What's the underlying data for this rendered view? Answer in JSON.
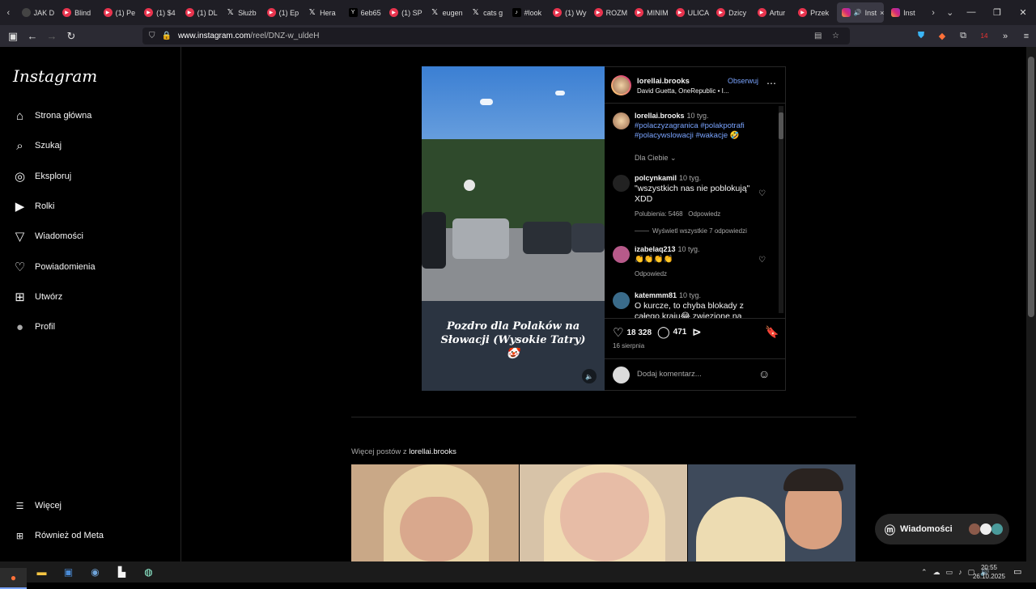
{
  "browser": {
    "tabs": [
      {
        "label": "JAK D",
        "icon": "generic"
      },
      {
        "label": "Blind",
        "icon": "youtube"
      },
      {
        "label": "(1) Pe",
        "icon": "youtube"
      },
      {
        "label": "(1) $4",
        "icon": "youtube"
      },
      {
        "label": "(1) DL",
        "icon": "youtube"
      },
      {
        "label": "Służb",
        "icon": "x"
      },
      {
        "label": "(1) Ep",
        "icon": "youtube"
      },
      {
        "label": "Hera",
        "icon": "x"
      },
      {
        "label": "6eb65",
        "icon": "y"
      },
      {
        "label": "(1) SP",
        "icon": "youtube"
      },
      {
        "label": "eugen",
        "icon": "x"
      },
      {
        "label": "cats g",
        "icon": "x"
      },
      {
        "label": "#look",
        "icon": "tiktok"
      },
      {
        "label": "(1) Wy",
        "icon": "youtube"
      },
      {
        "label": "ROZM",
        "icon": "youtube"
      },
      {
        "label": "MINIM",
        "icon": "youtube"
      },
      {
        "label": "ULICA",
        "icon": "youtube"
      },
      {
        "label": "Dzicy",
        "icon": "youtube"
      },
      {
        "label": "Artur",
        "icon": "youtube"
      },
      {
        "label": "Przek",
        "icon": "youtube"
      }
    ],
    "active_tab": {
      "label": "Inst"
    },
    "after_tab": {
      "label": "Inst"
    },
    "url_prefix": "www.instagram.com",
    "url_path": "/reel/DNZ-w_uldeH",
    "extension_badge": "14"
  },
  "sidebar": {
    "logo": "Instagram",
    "items": [
      {
        "label": "Strona główna",
        "icon": "home-icon"
      },
      {
        "label": "Szukaj",
        "icon": "search-icon"
      },
      {
        "label": "Eksploruj",
        "icon": "compass-icon"
      },
      {
        "label": "Rolki",
        "icon": "reels-icon"
      },
      {
        "label": "Wiadomości",
        "icon": "send-icon"
      },
      {
        "label": "Powiadomienia",
        "icon": "heart-icon"
      },
      {
        "label": "Utwórz",
        "icon": "plus-square-icon"
      },
      {
        "label": "Profil",
        "icon": "profile-avatar"
      }
    ],
    "bottom_items": [
      {
        "label": "Więcej",
        "icon": "menu-icon"
      },
      {
        "label": "Również od Meta",
        "icon": "meta-icon"
      }
    ]
  },
  "post": {
    "caption_overlay": "Pozdro dla Polaków na Słowacji (Wysokie Tatry) 🤡",
    "username": "lorellai.brooks",
    "follow_label": "Obserwuj",
    "music": "David Guetta, OneRepublic • I...",
    "caption": {
      "username": "lorellai.brooks",
      "time": "10 tyg.",
      "hashtags": "#polaczyzagranica #polakpotrafi #polacywslowacji #wakacje",
      "emoji": "🤣"
    },
    "for_you_label": "Dla Ciebie",
    "comments": [
      {
        "username": "polcynkamil",
        "time": "10 tyg.",
        "text": "\"wszystkich nas nie poblokują\" XDD",
        "likes": "Polubienia: 5468",
        "reply": "Odpowiedz",
        "view_replies": "Wyświetl wszystkie 7 odpowiedzi"
      },
      {
        "username": "izabelaq213",
        "time": "10 tyg.",
        "text": "👏👏👏👏",
        "reply": "Odpowiedz"
      },
      {
        "username": "katemmm81",
        "time": "10 tyg.",
        "text": "O kurcze, to chyba blokady z całego kraju😂 zwiezione na"
      }
    ],
    "likes_count": "18 328",
    "comments_count": "471",
    "date": "16 sierpnia",
    "add_comment_placeholder": "Dodaj komentarz..."
  },
  "more_posts": {
    "prefix": "Więcej postów z",
    "username": "lorellai.brooks"
  },
  "messages_button": {
    "label": "Wiadomości"
  },
  "taskbar": {
    "time": "20:55",
    "date": "26.10.2025"
  },
  "colors": {
    "link_blue": "#7aa4ff",
    "background": "#000000",
    "tabbar": "#1f1e25"
  }
}
